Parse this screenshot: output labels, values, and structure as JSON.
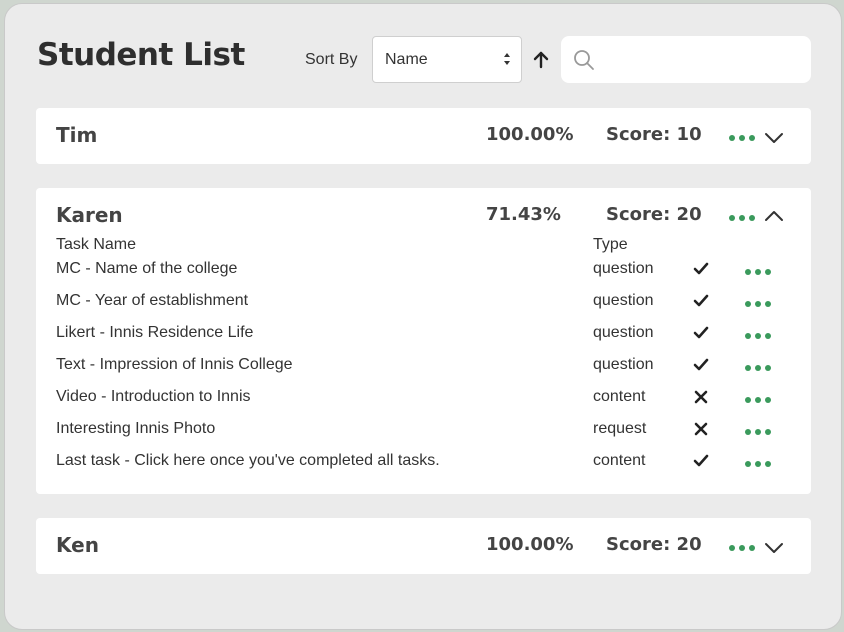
{
  "header": {
    "title": "Student List",
    "sort_label": "Sort By",
    "sort_value": "Name",
    "sort_direction_icon": "arrow-up-icon",
    "search_placeholder": "",
    "search_value": ""
  },
  "students": [
    {
      "name": "Tim",
      "percent": "100.00%",
      "score": "Score: 10",
      "expanded": false
    },
    {
      "name": "Karen",
      "percent": "71.43%",
      "score": "Score: 20",
      "expanded": true,
      "task_headers": {
        "name": "Task Name",
        "type": "Type"
      },
      "tasks": [
        {
          "name": "MC - Name of the college",
          "type": "question",
          "done": true
        },
        {
          "name": "MC - Year of establishment",
          "type": "question",
          "done": true
        },
        {
          "name": "Likert - Innis Residence Life",
          "type": "question",
          "done": true
        },
        {
          "name": "Text - Impression of Innis College",
          "type": "question",
          "done": true
        },
        {
          "name": "Video - Introduction to Innis",
          "type": "content",
          "done": false
        },
        {
          "name": "Interesting Innis Photo",
          "type": "request",
          "done": false
        },
        {
          "name": "Last task - Click here once you've completed all tasks.",
          "type": "content",
          "done": true
        }
      ]
    },
    {
      "name": "Ken",
      "percent": "100.00%",
      "score": "Score: 20",
      "expanded": false
    }
  ],
  "colors": {
    "accent_green": "#3a9a5c",
    "panel_bg": "#ebebeb",
    "card_bg": "#ffffff",
    "text_dark": "#444444"
  }
}
